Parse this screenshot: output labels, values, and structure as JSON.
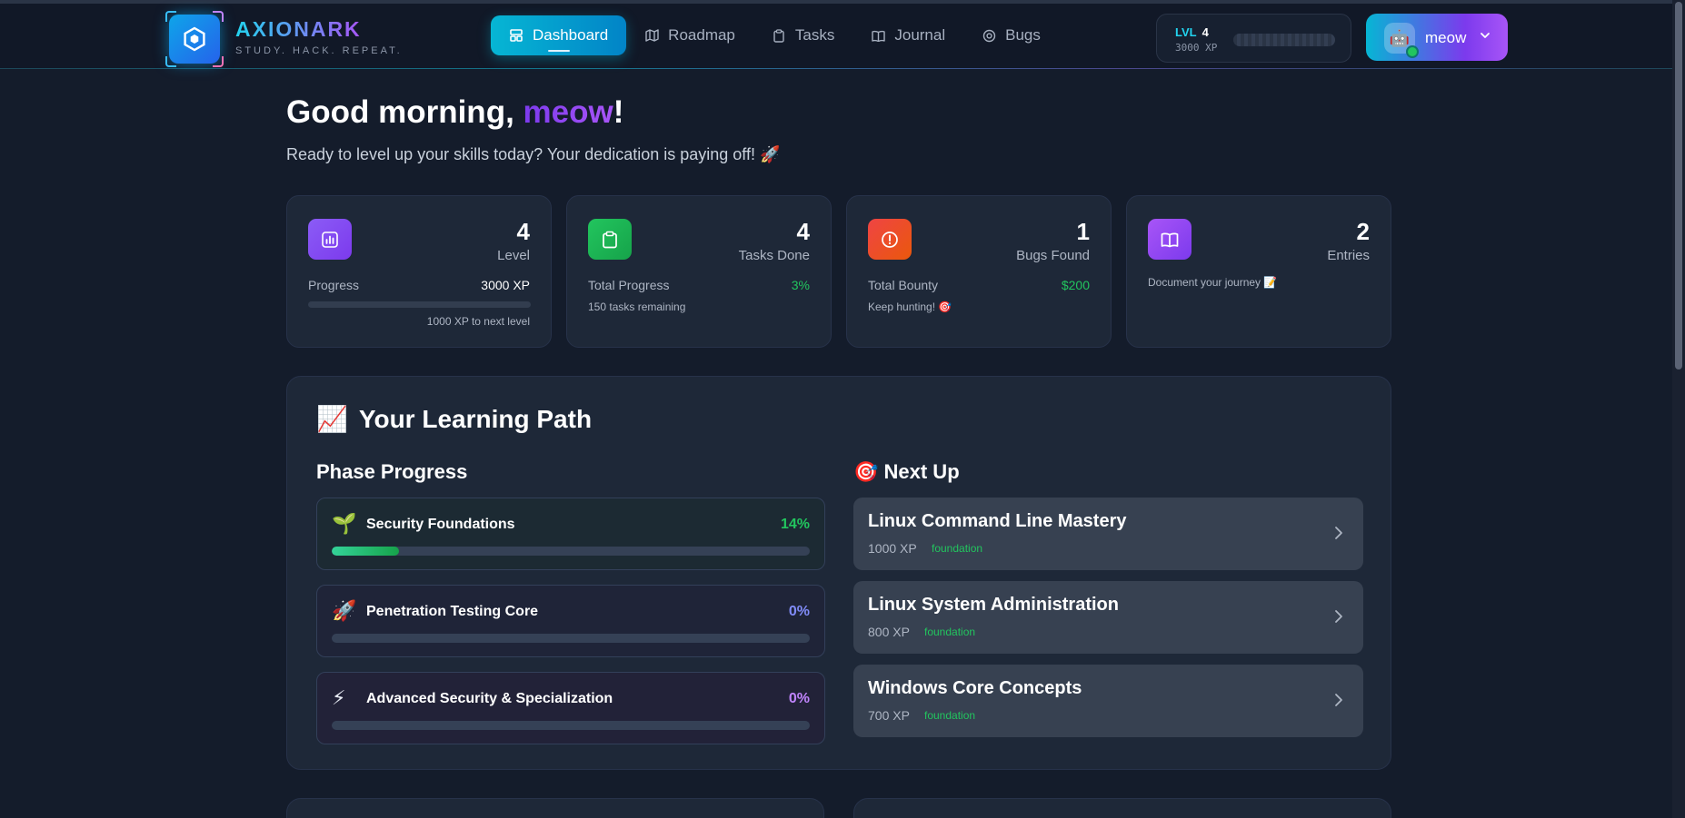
{
  "brand": {
    "name": "AXIONARK",
    "tagline": "STUDY. HACK. REPEAT."
  },
  "nav": [
    {
      "label": "Dashboard",
      "icon": "dashboard-icon",
      "active": true
    },
    {
      "label": "Roadmap",
      "icon": "map-icon",
      "active": false
    },
    {
      "label": "Tasks",
      "icon": "clipboard-icon",
      "active": false
    },
    {
      "label": "Journal",
      "icon": "book-icon",
      "active": false
    },
    {
      "label": "Bugs",
      "icon": "target-icon",
      "active": false
    }
  ],
  "level_box": {
    "lvl_key": "LVL",
    "lvl_value": "4",
    "xp_text": "3000 XP"
  },
  "user": {
    "name": "meow",
    "avatar": "🤖"
  },
  "greeting": {
    "prefix": "Good morning, ",
    "name": "meow",
    "suffix": "!",
    "subtitle": "Ready to level up your skills today? Your dedication is paying off! 🚀"
  },
  "stats": {
    "level": {
      "value": "4",
      "label": "Level",
      "row_label": "Progress",
      "row_value": "3000 XP",
      "progress": 0,
      "note": "1000 XP to next level"
    },
    "tasks": {
      "value": "4",
      "label": "Tasks Done",
      "row_label": "Total Progress",
      "row_value": "3%",
      "note": "150 tasks remaining"
    },
    "bugs": {
      "value": "1",
      "label": "Bugs Found",
      "row_label": "Total Bounty",
      "row_value": "$200",
      "note": "Keep hunting! 🎯"
    },
    "journal": {
      "value": "2",
      "label": "Entries",
      "note": "Document your journey 📝"
    }
  },
  "learning": {
    "title_emoji": "📈",
    "title": "Your Learning Path",
    "phase_heading": "Phase Progress",
    "next_heading": "🎯 Next Up",
    "phases": [
      {
        "emoji": "🌱",
        "name": "Security Foundations",
        "pct_label": "14%",
        "progress": 0.14,
        "color": "#22c55e"
      },
      {
        "emoji": "🚀",
        "name": "Penetration Testing Core",
        "pct_label": "0%",
        "progress": 0,
        "color": "#818cf8"
      },
      {
        "emoji": "⚡",
        "name": "Advanced Security & Specialization",
        "pct_label": "0%",
        "progress": 0,
        "color": "#c084fc"
      }
    ],
    "next_up": [
      {
        "title": "Linux Command Line Mastery",
        "xp": "1000 XP",
        "tag": "foundation"
      },
      {
        "title": "Linux System Administration",
        "xp": "800 XP",
        "tag": "foundation"
      },
      {
        "title": "Windows Core Concepts",
        "xp": "700 XP",
        "tag": "foundation"
      }
    ]
  },
  "colors": {
    "accent_cyan": "#06b6d4",
    "accent_purple": "#a855f7",
    "success": "#22c55e",
    "danger": "#ef4444"
  }
}
